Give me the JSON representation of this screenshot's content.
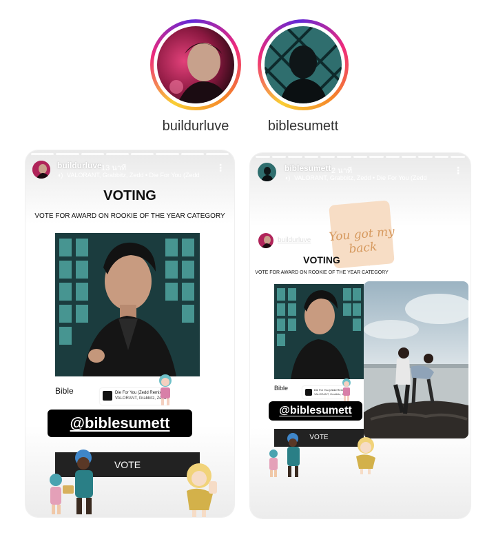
{
  "profiles": [
    {
      "username": "buildurluve"
    },
    {
      "username": "biblesumett"
    }
  ],
  "story_left": {
    "username": "buildurluve",
    "time": "13 นาที",
    "music": "VALORANT, Grabbitz, Zedd • Die For You (Zedd",
    "more_icon": "more-vertical-icon",
    "title": "VOTING",
    "subtitle": "VOTE FOR AWARD ON ROOKIE OF THE YEAR CATEGORY",
    "name_label": "Bible",
    "music_sticker": {
      "title": "Die For You (Zedd Remix)",
      "artists": "VALORANT, Grabbitz, Zedd"
    },
    "mention": "@biblesumett",
    "vote_button": "VOTE"
  },
  "story_right": {
    "username": "biblesumett",
    "time": "2 นาที",
    "music": "VALORANT, Grabbitz, Zedd • Die For You (Zedd",
    "more_icon": "more-vertical-icon",
    "reshared_from": "buildurluve",
    "note_text": "You got my back",
    "title": "VOTING",
    "subtitle": "VOTE FOR AWARD ON ROOKIE OF THE YEAR CATEGORY",
    "name_label": "Bible",
    "music_sticker": {
      "title": "Die For You (Zedd Remix)",
      "artists": "VALORANT, Grabbitz, Zedd"
    },
    "mention": "@biblesumett",
    "vote_button": "VOTE"
  },
  "colors": {
    "ring_start": "#f9ce34",
    "ring_mid": "#ee2a7b",
    "ring_end": "#6228d7",
    "note_bg": "#f7ddc5",
    "note_text": "#d6995e"
  }
}
